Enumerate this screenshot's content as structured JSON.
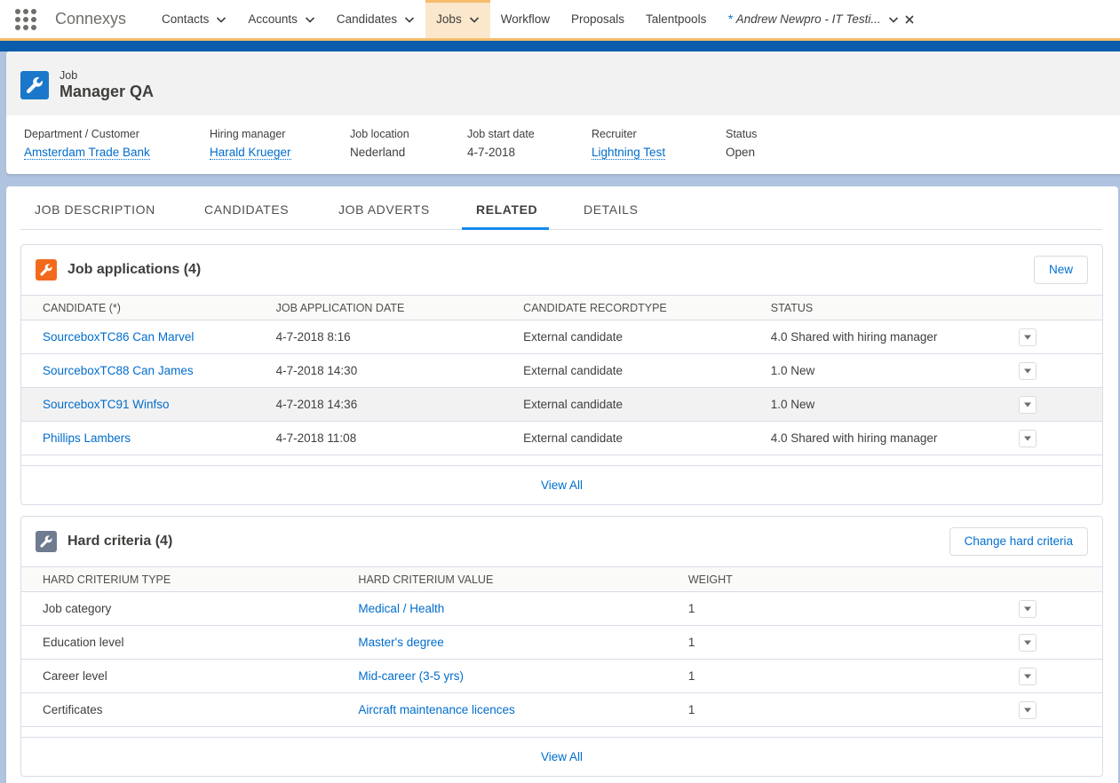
{
  "app": {
    "name": "Connexys"
  },
  "nav": {
    "items": [
      {
        "label": "Contacts",
        "dropdown": true,
        "active": false
      },
      {
        "label": "Accounts",
        "dropdown": true,
        "active": false
      },
      {
        "label": "Candidates",
        "dropdown": true,
        "active": false
      },
      {
        "label": "Jobs",
        "dropdown": true,
        "active": true
      },
      {
        "label": "Workflow",
        "dropdown": false,
        "active": false
      },
      {
        "label": "Proposals",
        "dropdown": false,
        "active": false
      },
      {
        "label": "Talentpools",
        "dropdown": false,
        "active": false
      }
    ],
    "subtab": {
      "modified_marker": "*",
      "label": "Andrew Newpro - IT Testi..."
    }
  },
  "record": {
    "type": "Job",
    "name": "Manager QA",
    "icon": "wrench-icon",
    "fields": [
      {
        "label": "Department / Customer",
        "value": "Amsterdam Trade Bank",
        "link": true
      },
      {
        "label": "Hiring manager",
        "value": "Harald Krueger",
        "link": true
      },
      {
        "label": "Job location",
        "value": "Nederland",
        "link": false
      },
      {
        "label": "Job start date",
        "value": "4-7-2018",
        "link": false
      },
      {
        "label": "Recruiter",
        "value": "Lightning Test",
        "link": true
      },
      {
        "label": "Status",
        "value": "Open",
        "link": false
      }
    ]
  },
  "tabs": [
    {
      "label": "JOB DESCRIPTION",
      "active": false
    },
    {
      "label": "CANDIDATES",
      "active": false
    },
    {
      "label": "JOB ADVERTS",
      "active": false
    },
    {
      "label": "RELATED",
      "active": true
    },
    {
      "label": "DETAILS",
      "active": false
    }
  ],
  "job_applications": {
    "title": "Job applications (4)",
    "icon_color": "#f26b1d",
    "button": "New",
    "columns": [
      "CANDIDATE (*)",
      "JOB APPLICATION DATE",
      "CANDIDATE RECORDTYPE",
      "STATUS"
    ],
    "rows": [
      [
        "SourceboxTC86 Can Marvel",
        "4-7-2018 8:16",
        "External candidate",
        "4.0 Shared with hiring manager"
      ],
      [
        "SourceboxTC88 Can James",
        "4-7-2018 14:30",
        "External candidate",
        "1.0 New"
      ],
      [
        "SourceboxTC91 Winfso",
        "4-7-2018 14:36",
        "External candidate",
        "1.0 New"
      ],
      [
        "Phillips Lambers",
        "4-7-2018 11:08",
        "External candidate",
        "4.0 Shared with hiring manager"
      ]
    ],
    "view_all": "View All"
  },
  "hard_criteria": {
    "title": "Hard criteria (4)",
    "icon_color": "#6f7b8f",
    "button": "Change hard criteria",
    "columns": [
      "HARD CRITERIUM TYPE",
      "HARD CRITERIUM VALUE",
      "WEIGHT"
    ],
    "rows": [
      [
        "Job category",
        "Medical / Health",
        "1"
      ],
      [
        "Education level",
        "Master's degree",
        "1"
      ],
      [
        "Career level",
        "Mid-career (3-5 yrs)",
        "1"
      ],
      [
        "Certificates",
        "Aircraft maintenance licences",
        "1"
      ]
    ],
    "view_all": "View All"
  }
}
